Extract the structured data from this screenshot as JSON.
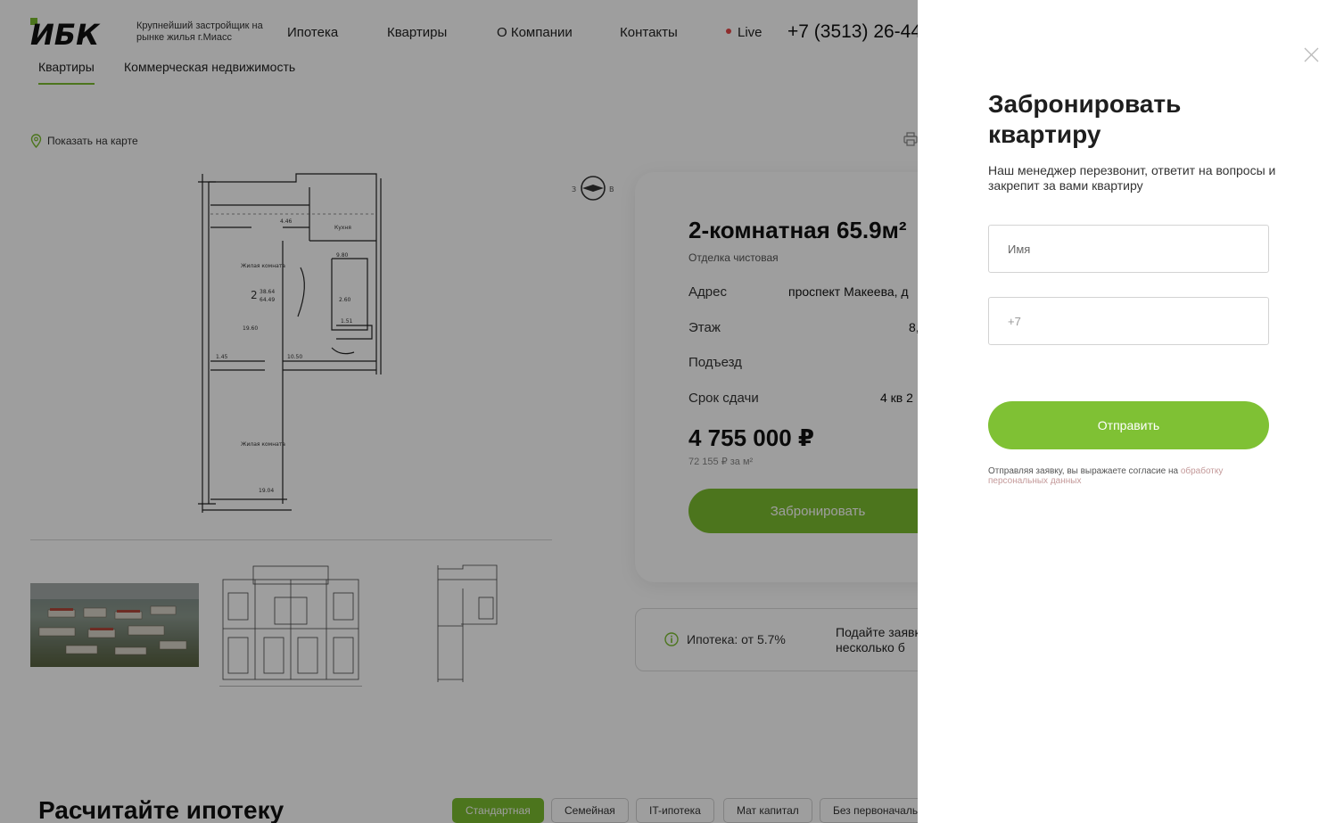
{
  "header": {
    "logo_text": "ИБК",
    "tagline": "Крупнейший застройщик на рынке жилья г.Миасс",
    "nav": [
      "Ипотека",
      "Квартиры",
      "О Компании",
      "Контакты"
    ],
    "live_label": "Live",
    "phone": "+7 (3513) 26-44"
  },
  "subtabs": [
    "Квартиры",
    "Коммерческая недвижимость"
  ],
  "map_link": "Показать на карте",
  "compass": {
    "west": "З",
    "east": "В"
  },
  "plan_labels": {
    "room1": "Жилая комната",
    "kitchen": "Кухня",
    "room2": "Жилая комната",
    "rooms_count": "2",
    "area_living": "38.64",
    "area_total": "64.49",
    "dims": [
      "4.46",
      "9.80",
      "2.60",
      "1.51",
      "19.60",
      "1.45",
      "10.50",
      "19.04"
    ]
  },
  "card": {
    "title": "2-комнатная 65.9м²",
    "finish": "Отделка чистовая",
    "rows": [
      {
        "label": "Адрес",
        "value": "проспект Макеева, д"
      },
      {
        "label": "Этаж",
        "value": "8,"
      },
      {
        "label": "Подъезд",
        "value": ""
      },
      {
        "label": "Срок сдачи",
        "value": "4 кв 2"
      }
    ],
    "price": "4 755 000 ₽",
    "price_per_sqm": "72 155 ₽ за м²",
    "book_button": "Забронировать"
  },
  "mortgage": {
    "info": "Ипотека: от 5.7%",
    "apply": "Подайте заявк в несколько б"
  },
  "calculator": {
    "title": "Расчитайте ипотеку",
    "tabs": [
      "Стандартная",
      "Семейная",
      "IT-ипотека",
      "Мат капитал",
      "Без первоначаль"
    ],
    "active_tab": 0
  },
  "drawer": {
    "title": "Забронировать квартиру",
    "subtitle": "Наш менеджер перезвонит, ответит на вопросы и закрепит за вами квартиру",
    "name_placeholder": "Имя",
    "phone_placeholder": "+7",
    "submit": "Отправить",
    "consent_text": "Отправляя заявку, вы выражаете согласие на ",
    "consent_link": "обработку персональных данных"
  },
  "colors": {
    "accent": "#7bbd2f",
    "overlay": "rgba(0,0,0,0.38)"
  }
}
